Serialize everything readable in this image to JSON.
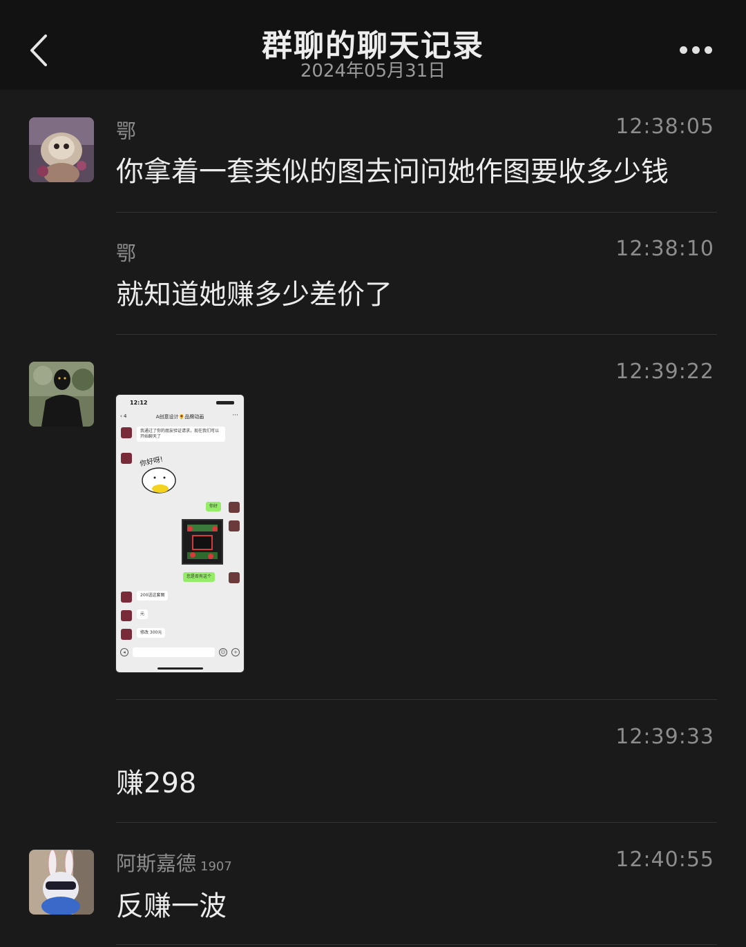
{
  "header": {
    "title": "群聊的聊天记录",
    "date": "2024年05月31日",
    "back_icon": "chevron-left-icon",
    "more_icon": "more-horizontal-icon"
  },
  "messages": [
    {
      "sender": "鄂",
      "time": "12:38:05",
      "text": "你拿着一套类似的图去问问她作图要收多少钱"
    },
    {
      "sender": "鄂",
      "time": "12:38:10",
      "text": "就知道她赚多少差价了"
    },
    {
      "sender": "",
      "time": "12:39:22",
      "type": "image"
    },
    {
      "sender": "",
      "time": "12:39:33",
      "text": "赚298"
    },
    {
      "sender": "阿斯嘉德",
      "sender_suffix": "1907",
      "time": "12:40:55",
      "text": "反赚一波"
    }
  ],
  "screenshot": {
    "status_time": "12:12",
    "nav_back": "‹ 4",
    "chat_title": "A创意设计🌻品牌动画",
    "more": "···",
    "msg1": "我通过了你的朋友验证请求，现在我们可以开始聊天了",
    "sticker_text": "你好呀!",
    "msg_hello": "你好",
    "msg_ask": "您是否有这个",
    "msg_price": "200送这套图",
    "msg_yuan": "元",
    "msg_edit": "修改 300元"
  }
}
